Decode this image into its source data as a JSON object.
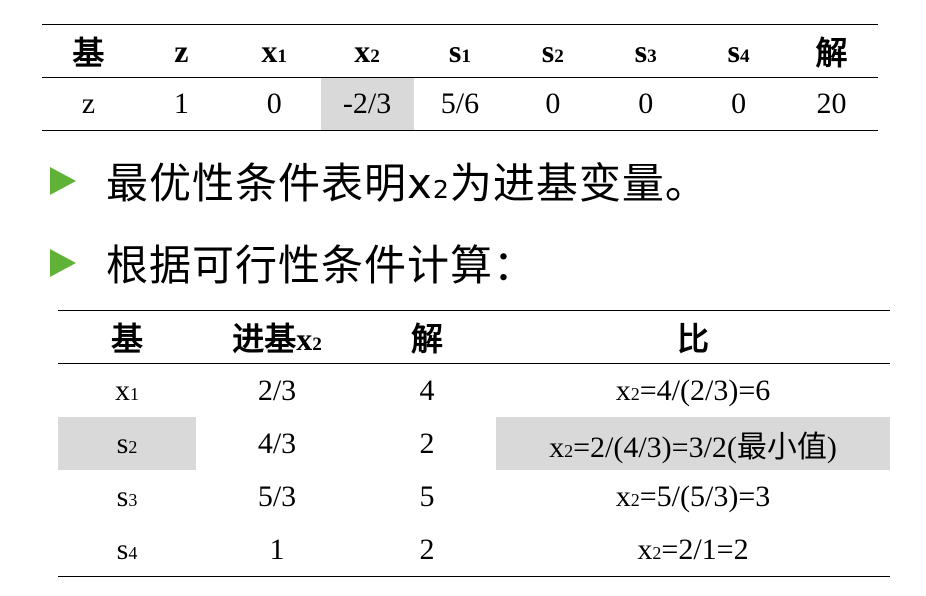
{
  "top_table": {
    "headers": [
      "基",
      "z",
      "x",
      "x",
      "s",
      "s",
      "s",
      "s",
      "解"
    ],
    "header_subs": [
      "",
      "",
      "1",
      "2",
      "1",
      "2",
      "3",
      "4",
      ""
    ],
    "row": [
      "z",
      "1",
      "0",
      "-2/3",
      "5/6",
      "0",
      "0",
      "0",
      "20"
    ],
    "highlight_col": 3
  },
  "bullets": [
    {
      "pre": "最优性条件表明x",
      "sub": "2",
      "post": "为进基变量。"
    },
    {
      "pre": "根据可行性条件计算：",
      "sub": "",
      "post": ""
    }
  ],
  "bottom_table": {
    "headers": {
      "basis": "基",
      "entering_pre": "进基x",
      "entering_sub": "2",
      "solution": "解",
      "ratio": "比"
    },
    "rows": [
      {
        "basis": "x",
        "basis_sub": "1",
        "entering": "2/3",
        "solution": "4",
        "ratio_pre": "x",
        "ratio_sub": "2",
        "ratio_post": "=4/(2/3)=6",
        "highlight": false
      },
      {
        "basis": "s",
        "basis_sub": "2",
        "entering": "4/3",
        "solution": "2",
        "ratio_pre": "x",
        "ratio_sub": "2",
        "ratio_post": "=2/(4/3)=3/2(最小值)",
        "highlight": true
      },
      {
        "basis": "s",
        "basis_sub": "3",
        "entering": "5/3",
        "solution": "5",
        "ratio_pre": "x",
        "ratio_sub": "2",
        "ratio_post": "=5/(5/3)=3",
        "highlight": false
      },
      {
        "basis": "s",
        "basis_sub": "4",
        "entering": "1",
        "solution": "2",
        "ratio_pre": "x",
        "ratio_sub": "2",
        "ratio_post": "=2/1=2",
        "highlight": false
      }
    ]
  },
  "colors": {
    "arrow": "#5fb236",
    "highlight": "#d9d9d9"
  }
}
